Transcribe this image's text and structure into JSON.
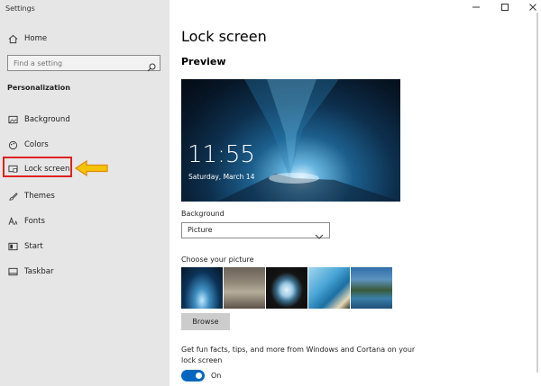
{
  "window": {
    "title": "Settings"
  },
  "sidebar": {
    "home_label": "Home",
    "search_placeholder": "Find a setting",
    "section_title": "Personalization",
    "items": [
      {
        "label": "Background",
        "icon": "image-icon"
      },
      {
        "label": "Colors",
        "icon": "palette-icon"
      },
      {
        "label": "Lock screen",
        "icon": "lock-screen-icon",
        "selected": true
      },
      {
        "label": "Themes",
        "icon": "brush-icon"
      },
      {
        "label": "Fonts",
        "icon": "font-icon"
      },
      {
        "label": "Start",
        "icon": "start-icon"
      },
      {
        "label": "Taskbar",
        "icon": "taskbar-icon"
      }
    ]
  },
  "main": {
    "title": "Lock screen",
    "preview_heading": "Preview",
    "preview": {
      "time": "11:55",
      "date": "Saturday, March 14"
    },
    "background_label": "Background",
    "background_value": "Picture",
    "choose_picture_label": "Choose your picture",
    "browse_label": "Browse",
    "fun_facts_text": "Get fun facts, tips, and more from Windows and Cortana on your lock screen",
    "toggle_state": "On"
  },
  "colors": {
    "accent": "#0067c0",
    "highlight": "#e02020",
    "arrow": "#f5c400"
  }
}
